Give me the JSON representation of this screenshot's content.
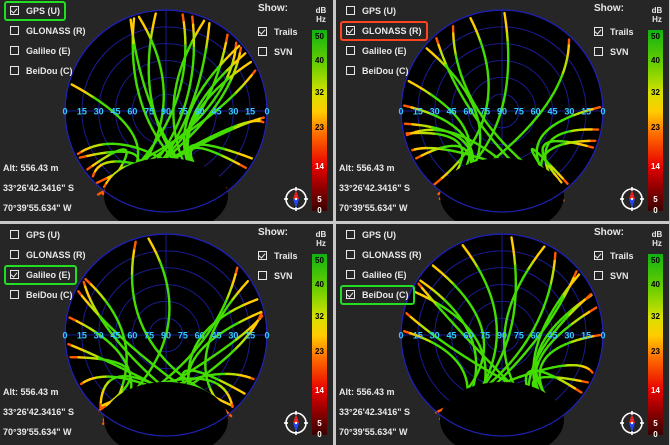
{
  "panels": [
    {
      "constellations": [
        {
          "label": "GPS (U)",
          "checked": true
        },
        {
          "label": "GLONASS (R)",
          "checked": false
        },
        {
          "label": "Galileo (E)",
          "checked": false
        },
        {
          "label": "BeiDou (C)",
          "checked": false
        }
      ],
      "selected": 0,
      "highlight": "#22dd22",
      "seed": 1,
      "count": 26
    },
    {
      "constellations": [
        {
          "label": "GPS (U)",
          "checked": false
        },
        {
          "label": "GLONASS (R)",
          "checked": true
        },
        {
          "label": "Galileo (E)",
          "checked": false
        },
        {
          "label": "BeiDou (C)",
          "checked": false
        }
      ],
      "selected": 1,
      "highlight": "#ff4422",
      "seed": 2,
      "count": 18
    },
    {
      "constellations": [
        {
          "label": "GPS (U)",
          "checked": false
        },
        {
          "label": "GLONASS (R)",
          "checked": false
        },
        {
          "label": "Galileo (E)",
          "checked": true
        },
        {
          "label": "BeiDou (C)",
          "checked": false
        }
      ],
      "selected": 2,
      "highlight": "#22dd22",
      "seed": 3,
      "count": 20
    },
    {
      "constellations": [
        {
          "label": "GPS (U)",
          "checked": false
        },
        {
          "label": "GLONASS (R)",
          "checked": false
        },
        {
          "label": "Galileo (E)",
          "checked": false
        },
        {
          "label": "BeiDou (C)",
          "checked": true
        }
      ],
      "selected": 3,
      "highlight": "#22dd22",
      "seed": 4,
      "count": 20
    }
  ],
  "show": {
    "label": "Show:",
    "trails": {
      "label": "Trails",
      "checked": true
    },
    "svn": {
      "label": "SVN",
      "checked": false
    }
  },
  "colorbar": {
    "unit_line1": "dB",
    "unit_line2": "Hz",
    "ticks": [
      "50",
      "40",
      "32",
      "23",
      "14",
      "5",
      "0"
    ]
  },
  "elevation_labels": [
    "0",
    "15",
    "30",
    "45",
    "60",
    "75",
    "90",
    "75",
    "60",
    "45",
    "30",
    "15",
    "0"
  ],
  "position": {
    "alt": "Alt: 556.43 m",
    "lat": "33°26'42.3416\" S",
    "lon": "70°39'55.634\" W"
  },
  "colors": {
    "background": "#262626",
    "sky": "#000000",
    "grid": "#1a1aa0",
    "elevation_label": "#33ccff",
    "high_snr": "#11b211",
    "low_snr": "#e80000"
  }
}
